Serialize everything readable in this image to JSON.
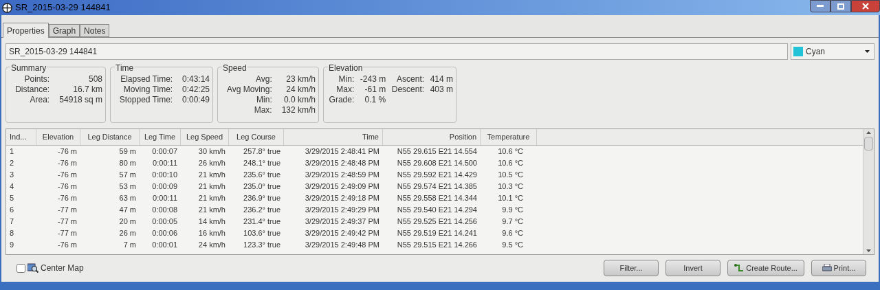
{
  "window": {
    "title": "SR_2015-03-29 144841"
  },
  "tabs": [
    {
      "label": "Properties",
      "selected": true
    },
    {
      "label": "Graph",
      "selected": false
    },
    {
      "label": "Notes",
      "selected": false
    }
  ],
  "name_field": {
    "value": "SR_2015-03-29 144841"
  },
  "color_dropdown": {
    "value": "Cyan",
    "color": "#22c3d6"
  },
  "groups": [
    {
      "title": "Summary",
      "rows": [
        [
          "Points:",
          "508"
        ],
        [
          "Distance:",
          "16.7 km"
        ],
        [
          "Area:",
          "54918 sq m"
        ]
      ]
    },
    {
      "title": "Time",
      "rows": [
        [
          "Elapsed Time:",
          "0:43:14"
        ],
        [
          "Moving Time:",
          "0:42:25"
        ],
        [
          "Stopped Time:",
          "0:00:49"
        ]
      ]
    },
    {
      "title": "Speed",
      "rows": [
        [
          "Avg:",
          "23 km/h"
        ],
        [
          "Avg Moving:",
          "24 km/h"
        ],
        [
          "Min:",
          "0.0 km/h"
        ],
        [
          "Max:",
          "132 km/h"
        ]
      ]
    },
    {
      "title": "Elevation",
      "rows": [
        [
          "Min:",
          "-243 m",
          "Ascent:",
          "414 m"
        ],
        [
          "Max:",
          "-61 m",
          "Descent:",
          "403 m"
        ],
        [
          "Grade:",
          "0.1 %"
        ]
      ]
    }
  ],
  "table": {
    "columns": [
      "Ind...",
      "Elevation",
      "Leg Distance",
      "Leg Time",
      "Leg Speed",
      "Leg Course",
      "Time",
      "Position",
      "Temperature"
    ],
    "rows": [
      [
        "1",
        "-76 m",
        "59 m",
        "0:00:07",
        "30 km/h",
        "257.8° true",
        "3/29/2015 2:48:41 PM",
        "N55 29.615 E21 14.554",
        "10.6 °C"
      ],
      [
        "2",
        "-76 m",
        "80 m",
        "0:00:11",
        "26 km/h",
        "248.1° true",
        "3/29/2015 2:48:48 PM",
        "N55 29.608 E21 14.500",
        "10.6 °C"
      ],
      [
        "3",
        "-76 m",
        "57 m",
        "0:00:10",
        "21 km/h",
        "235.6° true",
        "3/29/2015 2:48:59 PM",
        "N55 29.592 E21 14.429",
        "10.5 °C"
      ],
      [
        "4",
        "-76 m",
        "53 m",
        "0:00:09",
        "21 km/h",
        "235.0° true",
        "3/29/2015 2:49:09 PM",
        "N55 29.574 E21 14.385",
        "10.3 °C"
      ],
      [
        "5",
        "-76 m",
        "63 m",
        "0:00:11",
        "21 km/h",
        "236.9° true",
        "3/29/2015 2:49:18 PM",
        "N55 29.558 E21 14.344",
        "10.1 °C"
      ],
      [
        "6",
        "-77 m",
        "47 m",
        "0:00:08",
        "21 km/h",
        "236.2° true",
        "3/29/2015 2:49:29 PM",
        "N55 29.540 E21 14.294",
        "9.9 °C"
      ],
      [
        "7",
        "-77 m",
        "20 m",
        "0:00:05",
        "14 km/h",
        "231.4° true",
        "3/29/2015 2:49:37 PM",
        "N55 29.525 E21 14.256",
        "9.7 °C"
      ],
      [
        "8",
        "-77 m",
        "26 m",
        "0:00:06",
        "16 km/h",
        "103.6° true",
        "3/29/2015 2:49:42 PM",
        "N55 29.519 E21 14.241",
        "9.6 °C"
      ],
      [
        "9",
        "-76 m",
        "7 m",
        "0:00:01",
        "24 km/h",
        "123.3° true",
        "3/29/2015 2:49:48 PM",
        "N55 29.515 E21 14.266",
        "9.5 °C"
      ]
    ]
  },
  "center_map": {
    "label": "Center Map",
    "checked": false
  },
  "buttons": [
    {
      "label": "Filter...",
      "kind": "plain"
    },
    {
      "label": "Invert",
      "kind": "plain"
    },
    {
      "label": "Create Route...",
      "kind": "route"
    },
    {
      "label": "Print...",
      "kind": "print"
    }
  ]
}
